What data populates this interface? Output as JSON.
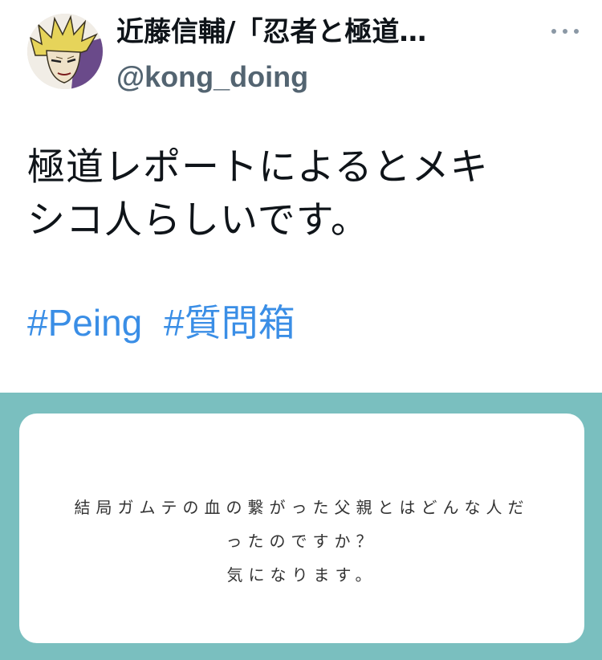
{
  "tweet": {
    "display_name": "近藤信輔/「忍者と極道…",
    "handle": "@kong_doing",
    "more_icon": "more-horizontal-icon",
    "text_lines": [
      "極道レポートによるとメキ",
      "シコ人らしいです。"
    ],
    "hashtags": [
      "#Peing",
      "#質問箱"
    ],
    "hashtag_color": "#3a8ee6"
  },
  "peing_card": {
    "background_color": "#7abfbf",
    "question_lines": [
      "結局ガムテの血の繋がった父親とはどんな人だ",
      "ったのですか？",
      "気になります。"
    ]
  }
}
